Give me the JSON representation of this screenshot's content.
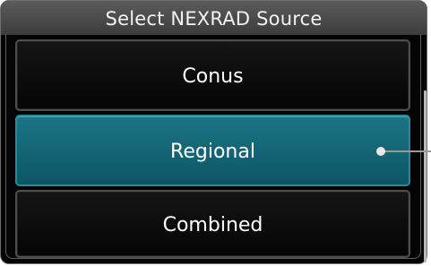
{
  "dialog": {
    "title": "Select NEXRAD Source"
  },
  "options": [
    {
      "label": "Conus",
      "selected": false
    },
    {
      "label": "Regional",
      "selected": true
    },
    {
      "label": "Combined",
      "selected": false
    }
  ],
  "colors": {
    "selected_bg": "#15687a",
    "normal_bg": "#0a0a0a",
    "title_bg": "#4a4a4a"
  }
}
